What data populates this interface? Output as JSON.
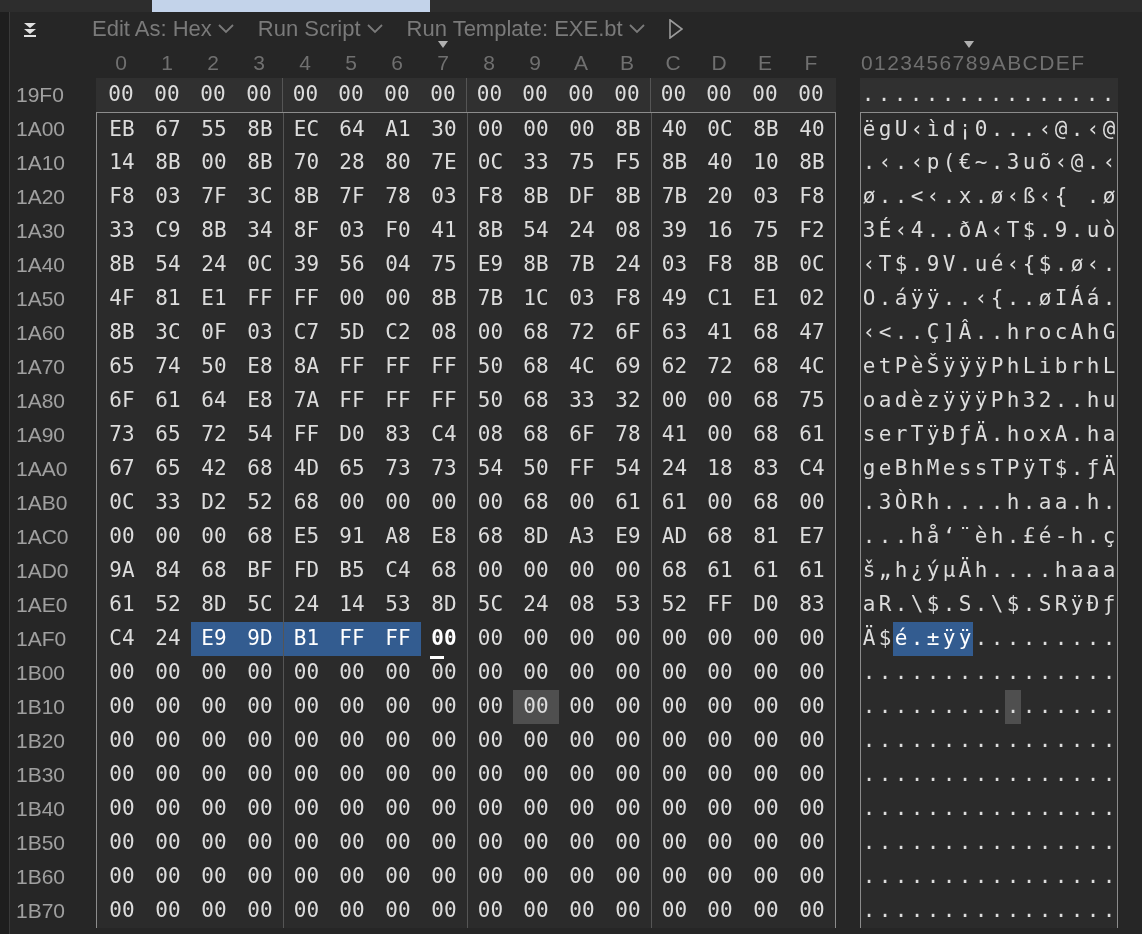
{
  "toolbar": [
    {
      "kind": "dropdown",
      "label": "Edit As: Hex"
    },
    {
      "kind": "dropdown",
      "label": "Run Script"
    },
    {
      "kind": "dropdown",
      "label": "Run Template: EXE.bt"
    },
    {
      "kind": "play"
    }
  ],
  "columns": [
    {
      "label": "0",
      "marked": false
    },
    {
      "label": "1",
      "marked": false
    },
    {
      "label": "2",
      "marked": false
    },
    {
      "label": "3",
      "marked": false
    },
    {
      "label": "4",
      "marked": false
    },
    {
      "label": "5",
      "marked": false
    },
    {
      "label": "6",
      "marked": false
    },
    {
      "label": "7",
      "marked": true
    },
    {
      "label": "8",
      "marked": false
    },
    {
      "label": "9",
      "marked": false
    },
    {
      "label": "A",
      "marked": false
    },
    {
      "label": "B",
      "marked": false
    },
    {
      "label": "C",
      "marked": false
    },
    {
      "label": "D",
      "marked": false
    },
    {
      "label": "E",
      "marked": false
    },
    {
      "label": "F",
      "marked": false
    }
  ],
  "ascii_header": "0123456789ABCDEF",
  "rows": [
    {
      "offset": "19F0",
      "in_template": false,
      "hex": "00 00 00 00 00 00 00 00 00 00 00 00 00 00 00 00",
      "ascii": "................",
      "selected": [
        false,
        false,
        false,
        false,
        false,
        false,
        false,
        false,
        false,
        false,
        false,
        false,
        false,
        false,
        false,
        false
      ],
      "cursor": [
        false,
        false,
        false,
        false,
        false,
        false,
        false,
        false,
        false,
        false,
        false,
        false,
        false,
        false,
        false,
        false
      ],
      "highlighted": [
        false,
        false,
        false,
        false,
        false,
        false,
        false,
        false,
        false,
        false,
        false,
        false,
        false,
        false,
        false,
        false
      ]
    },
    {
      "offset": "1A00",
      "in_template": true,
      "hex": "EB 67 55 8B EC 64 A1 30 00 00 00 8B 40 0C 8B 40",
      "ascii": "ëgU‹ìd¡0...‹@.‹@",
      "selected": [
        false,
        false,
        false,
        false,
        false,
        false,
        false,
        false,
        false,
        false,
        false,
        false,
        false,
        false,
        false,
        false
      ],
      "cursor": [
        false,
        false,
        false,
        false,
        false,
        false,
        false,
        false,
        false,
        false,
        false,
        false,
        false,
        false,
        false,
        false
      ],
      "highlighted": [
        false,
        false,
        false,
        false,
        false,
        false,
        false,
        false,
        false,
        false,
        false,
        false,
        false,
        false,
        false,
        false
      ]
    },
    {
      "offset": "1A10",
      "in_template": true,
      "hex": "14 8B 00 8B 70 28 80 7E 0C 33 75 F5 8B 40 10 8B",
      "ascii": ".‹.‹p(€~.3uõ‹@.‹",
      "selected": [
        false,
        false,
        false,
        false,
        false,
        false,
        false,
        false,
        false,
        false,
        false,
        false,
        false,
        false,
        false,
        false
      ],
      "cursor": [
        false,
        false,
        false,
        false,
        false,
        false,
        false,
        false,
        false,
        false,
        false,
        false,
        false,
        false,
        false,
        false
      ],
      "highlighted": [
        false,
        false,
        false,
        false,
        false,
        false,
        false,
        false,
        false,
        false,
        false,
        false,
        false,
        false,
        false,
        false
      ]
    },
    {
      "offset": "1A20",
      "in_template": true,
      "hex": "F8 03 7F 3C 8B 7F 78 03 F8 8B DF 8B 7B 20 03 F8",
      "ascii": "ø..<‹.x.ø‹ß‹{ .ø",
      "selected": [
        false,
        false,
        false,
        false,
        false,
        false,
        false,
        false,
        false,
        false,
        false,
        false,
        false,
        false,
        false,
        false
      ],
      "cursor": [
        false,
        false,
        false,
        false,
        false,
        false,
        false,
        false,
        false,
        false,
        false,
        false,
        false,
        false,
        false,
        false
      ],
      "highlighted": [
        false,
        false,
        false,
        false,
        false,
        false,
        false,
        false,
        false,
        false,
        false,
        false,
        false,
        false,
        false,
        false
      ]
    },
    {
      "offset": "1A30",
      "in_template": true,
      "hex": "33 C9 8B 34 8F 03 F0 41 8B 54 24 08 39 16 75 F2",
      "ascii": "3É‹4..ðA‹T$.9.uò",
      "selected": [
        false,
        false,
        false,
        false,
        false,
        false,
        false,
        false,
        false,
        false,
        false,
        false,
        false,
        false,
        false,
        false
      ],
      "cursor": [
        false,
        false,
        false,
        false,
        false,
        false,
        false,
        false,
        false,
        false,
        false,
        false,
        false,
        false,
        false,
        false
      ],
      "highlighted": [
        false,
        false,
        false,
        false,
        false,
        false,
        false,
        false,
        false,
        false,
        false,
        false,
        false,
        false,
        false,
        false
      ]
    },
    {
      "offset": "1A40",
      "in_template": true,
      "hex": "8B 54 24 0C 39 56 04 75 E9 8B 7B 24 03 F8 8B 0C",
      "ascii": "‹T$.9V.ué‹{$.ø‹.",
      "selected": [
        false,
        false,
        false,
        false,
        false,
        false,
        false,
        false,
        false,
        false,
        false,
        false,
        false,
        false,
        false,
        false
      ],
      "cursor": [
        false,
        false,
        false,
        false,
        false,
        false,
        false,
        false,
        false,
        false,
        false,
        false,
        false,
        false,
        false,
        false
      ],
      "highlighted": [
        false,
        false,
        false,
        false,
        false,
        false,
        false,
        false,
        false,
        false,
        false,
        false,
        false,
        false,
        false,
        false
      ]
    },
    {
      "offset": "1A50",
      "in_template": true,
      "hex": "4F 81 E1 FF FF 00 00 8B 7B 1C 03 F8 49 C1 E1 02",
      "ascii": "O.áÿÿ..‹{..øIÁá.",
      "selected": [
        false,
        false,
        false,
        false,
        false,
        false,
        false,
        false,
        false,
        false,
        false,
        false,
        false,
        false,
        false,
        false
      ],
      "cursor": [
        false,
        false,
        false,
        false,
        false,
        false,
        false,
        false,
        false,
        false,
        false,
        false,
        false,
        false,
        false,
        false
      ],
      "highlighted": [
        false,
        false,
        false,
        false,
        false,
        false,
        false,
        false,
        false,
        false,
        false,
        false,
        false,
        false,
        false,
        false
      ]
    },
    {
      "offset": "1A60",
      "in_template": true,
      "hex": "8B 3C 0F 03 C7 5D C2 08 00 68 72 6F 63 41 68 47",
      "ascii": "‹<..Ç]Â..hrocAhG",
      "selected": [
        false,
        false,
        false,
        false,
        false,
        false,
        false,
        false,
        false,
        false,
        false,
        false,
        false,
        false,
        false,
        false
      ],
      "cursor": [
        false,
        false,
        false,
        false,
        false,
        false,
        false,
        false,
        false,
        false,
        false,
        false,
        false,
        false,
        false,
        false
      ],
      "highlighted": [
        false,
        false,
        false,
        false,
        false,
        false,
        false,
        false,
        false,
        false,
        false,
        false,
        false,
        false,
        false,
        false
      ]
    },
    {
      "offset": "1A70",
      "in_template": true,
      "hex": "65 74 50 E8 8A FF FF FF 50 68 4C 69 62 72 68 4C",
      "ascii": "etPèŠÿÿÿPhLibrhL",
      "selected": [
        false,
        false,
        false,
        false,
        false,
        false,
        false,
        false,
        false,
        false,
        false,
        false,
        false,
        false,
        false,
        false
      ],
      "cursor": [
        false,
        false,
        false,
        false,
        false,
        false,
        false,
        false,
        false,
        false,
        false,
        false,
        false,
        false,
        false,
        false
      ],
      "highlighted": [
        false,
        false,
        false,
        false,
        false,
        false,
        false,
        false,
        false,
        false,
        false,
        false,
        false,
        false,
        false,
        false
      ]
    },
    {
      "offset": "1A80",
      "in_template": true,
      "hex": "6F 61 64 E8 7A FF FF FF 50 68 33 32 00 00 68 75",
      "ascii": "oadèzÿÿÿPh32..hu",
      "selected": [
        false,
        false,
        false,
        false,
        false,
        false,
        false,
        false,
        false,
        false,
        false,
        false,
        false,
        false,
        false,
        false
      ],
      "cursor": [
        false,
        false,
        false,
        false,
        false,
        false,
        false,
        false,
        false,
        false,
        false,
        false,
        false,
        false,
        false,
        false
      ],
      "highlighted": [
        false,
        false,
        false,
        false,
        false,
        false,
        false,
        false,
        false,
        false,
        false,
        false,
        false,
        false,
        false,
        false
      ]
    },
    {
      "offset": "1A90",
      "in_template": true,
      "hex": "73 65 72 54 FF D0 83 C4 08 68 6F 78 41 00 68 61",
      "ascii": "serTÿÐƒÄ.hoxA.ha",
      "selected": [
        false,
        false,
        false,
        false,
        false,
        false,
        false,
        false,
        false,
        false,
        false,
        false,
        false,
        false,
        false,
        false
      ],
      "cursor": [
        false,
        false,
        false,
        false,
        false,
        false,
        false,
        false,
        false,
        false,
        false,
        false,
        false,
        false,
        false,
        false
      ],
      "highlighted": [
        false,
        false,
        false,
        false,
        false,
        false,
        false,
        false,
        false,
        false,
        false,
        false,
        false,
        false,
        false,
        false
      ]
    },
    {
      "offset": "1AA0",
      "in_template": true,
      "hex": "67 65 42 68 4D 65 73 73 54 50 FF 54 24 18 83 C4",
      "ascii": "geBhMessTPÿT$.ƒÄ",
      "selected": [
        false,
        false,
        false,
        false,
        false,
        false,
        false,
        false,
        false,
        false,
        false,
        false,
        false,
        false,
        false,
        false
      ],
      "cursor": [
        false,
        false,
        false,
        false,
        false,
        false,
        false,
        false,
        false,
        false,
        false,
        false,
        false,
        false,
        false,
        false
      ],
      "highlighted": [
        false,
        false,
        false,
        false,
        false,
        false,
        false,
        false,
        false,
        false,
        false,
        false,
        false,
        false,
        false,
        false
      ]
    },
    {
      "offset": "1AB0",
      "in_template": true,
      "hex": "0C 33 D2 52 68 00 00 00 00 68 00 61 61 00 68 00",
      "ascii": ".3ÒRh....h.aa.h.",
      "selected": [
        false,
        false,
        false,
        false,
        false,
        false,
        false,
        false,
        false,
        false,
        false,
        false,
        false,
        false,
        false,
        false
      ],
      "cursor": [
        false,
        false,
        false,
        false,
        false,
        false,
        false,
        false,
        false,
        false,
        false,
        false,
        false,
        false,
        false,
        false
      ],
      "highlighted": [
        false,
        false,
        false,
        false,
        false,
        false,
        false,
        false,
        false,
        false,
        false,
        false,
        false,
        false,
        false,
        false
      ]
    },
    {
      "offset": "1AC0",
      "in_template": true,
      "hex": "00 00 00 68 E5 91 A8 E8 68 8D A3 E9 AD 68 81 E7",
      "ascii": "...hå‘¨èh.£é-h.ç",
      "selected": [
        false,
        false,
        false,
        false,
        false,
        false,
        false,
        false,
        false,
        false,
        false,
        false,
        false,
        false,
        false,
        false
      ],
      "cursor": [
        false,
        false,
        false,
        false,
        false,
        false,
        false,
        false,
        false,
        false,
        false,
        false,
        false,
        false,
        false,
        false
      ],
      "highlighted": [
        false,
        false,
        false,
        false,
        false,
        false,
        false,
        false,
        false,
        false,
        false,
        false,
        false,
        false,
        false,
        false
      ]
    },
    {
      "offset": "1AD0",
      "in_template": true,
      "hex": "9A 84 68 BF FD B5 C4 68 00 00 00 00 68 61 61 61",
      "ascii": "š„h¿ýµÄh....haaa",
      "selected": [
        false,
        false,
        false,
        false,
        false,
        false,
        false,
        false,
        false,
        false,
        false,
        false,
        false,
        false,
        false,
        false
      ],
      "cursor": [
        false,
        false,
        false,
        false,
        false,
        false,
        false,
        false,
        false,
        false,
        false,
        false,
        false,
        false,
        false,
        false
      ],
      "highlighted": [
        false,
        false,
        false,
        false,
        false,
        false,
        false,
        false,
        false,
        false,
        false,
        false,
        false,
        false,
        false,
        false
      ]
    },
    {
      "offset": "1AE0",
      "in_template": true,
      "hex": "61 52 8D 5C 24 14 53 8D 5C 24 08 53 52 FF D0 83",
      "ascii": "aR.\\$.S.\\$.SRÿÐƒ",
      "selected": [
        false,
        false,
        false,
        false,
        false,
        false,
        false,
        false,
        false,
        false,
        false,
        false,
        false,
        false,
        false,
        false
      ],
      "cursor": [
        false,
        false,
        false,
        false,
        false,
        false,
        false,
        false,
        false,
        false,
        false,
        false,
        false,
        false,
        false,
        false
      ],
      "highlighted": [
        false,
        false,
        false,
        false,
        false,
        false,
        false,
        false,
        false,
        false,
        false,
        false,
        false,
        false,
        false,
        false
      ]
    },
    {
      "offset": "1AF0",
      "in_template": true,
      "hex": "C4 24 E9 9D B1 FF FF 00 00 00 00 00 00 00 00 00",
      "ascii": "Ä$é.±ÿÿ.........",
      "selected": [
        false,
        false,
        true,
        true,
        true,
        true,
        true,
        false,
        false,
        false,
        false,
        false,
        false,
        false,
        false,
        false
      ],
      "cursor": [
        false,
        false,
        false,
        false,
        false,
        false,
        false,
        true,
        false,
        false,
        false,
        false,
        false,
        false,
        false,
        false
      ],
      "highlighted": [
        false,
        false,
        false,
        false,
        false,
        false,
        false,
        false,
        false,
        false,
        false,
        false,
        false,
        false,
        false,
        false
      ]
    },
    {
      "offset": "1B00",
      "in_template": true,
      "hex": "00 00 00 00 00 00 00 00 00 00 00 00 00 00 00 00",
      "ascii": "................",
      "selected": [
        false,
        false,
        false,
        false,
        false,
        false,
        false,
        false,
        false,
        false,
        false,
        false,
        false,
        false,
        false,
        false
      ],
      "cursor": [
        false,
        false,
        false,
        false,
        false,
        false,
        false,
        false,
        false,
        false,
        false,
        false,
        false,
        false,
        false,
        false
      ],
      "highlighted": [
        false,
        false,
        false,
        false,
        false,
        false,
        false,
        false,
        false,
        false,
        false,
        false,
        false,
        false,
        false,
        false
      ]
    },
    {
      "offset": "1B10",
      "in_template": true,
      "hex": "00 00 00 00 00 00 00 00 00 00 00 00 00 00 00 00",
      "ascii": "................",
      "selected": [
        false,
        false,
        false,
        false,
        false,
        false,
        false,
        false,
        false,
        false,
        false,
        false,
        false,
        false,
        false,
        false
      ],
      "cursor": [
        false,
        false,
        false,
        false,
        false,
        false,
        false,
        false,
        false,
        false,
        false,
        false,
        false,
        false,
        false,
        false
      ],
      "highlighted": [
        false,
        false,
        false,
        false,
        false,
        false,
        false,
        false,
        false,
        true,
        false,
        false,
        false,
        false,
        false,
        false
      ]
    },
    {
      "offset": "1B20",
      "in_template": true,
      "hex": "00 00 00 00 00 00 00 00 00 00 00 00 00 00 00 00",
      "ascii": "................",
      "selected": [
        false,
        false,
        false,
        false,
        false,
        false,
        false,
        false,
        false,
        false,
        false,
        false,
        false,
        false,
        false,
        false
      ],
      "cursor": [
        false,
        false,
        false,
        false,
        false,
        false,
        false,
        false,
        false,
        false,
        false,
        false,
        false,
        false,
        false,
        false
      ],
      "highlighted": [
        false,
        false,
        false,
        false,
        false,
        false,
        false,
        false,
        false,
        false,
        false,
        false,
        false,
        false,
        false,
        false
      ]
    },
    {
      "offset": "1B30",
      "in_template": true,
      "hex": "00 00 00 00 00 00 00 00 00 00 00 00 00 00 00 00",
      "ascii": "................",
      "selected": [
        false,
        false,
        false,
        false,
        false,
        false,
        false,
        false,
        false,
        false,
        false,
        false,
        false,
        false,
        false,
        false
      ],
      "cursor": [
        false,
        false,
        false,
        false,
        false,
        false,
        false,
        false,
        false,
        false,
        false,
        false,
        false,
        false,
        false,
        false
      ],
      "highlighted": [
        false,
        false,
        false,
        false,
        false,
        false,
        false,
        false,
        false,
        false,
        false,
        false,
        false,
        false,
        false,
        false
      ]
    },
    {
      "offset": "1B40",
      "in_template": true,
      "hex": "00 00 00 00 00 00 00 00 00 00 00 00 00 00 00 00",
      "ascii": "................",
      "selected": [
        false,
        false,
        false,
        false,
        false,
        false,
        false,
        false,
        false,
        false,
        false,
        false,
        false,
        false,
        false,
        false
      ],
      "cursor": [
        false,
        false,
        false,
        false,
        false,
        false,
        false,
        false,
        false,
        false,
        false,
        false,
        false,
        false,
        false,
        false
      ],
      "highlighted": [
        false,
        false,
        false,
        false,
        false,
        false,
        false,
        false,
        false,
        false,
        false,
        false,
        false,
        false,
        false,
        false
      ]
    },
    {
      "offset": "1B50",
      "in_template": true,
      "hex": "00 00 00 00 00 00 00 00 00 00 00 00 00 00 00 00",
      "ascii": "................",
      "selected": [
        false,
        false,
        false,
        false,
        false,
        false,
        false,
        false,
        false,
        false,
        false,
        false,
        false,
        false,
        false,
        false
      ],
      "cursor": [
        false,
        false,
        false,
        false,
        false,
        false,
        false,
        false,
        false,
        false,
        false,
        false,
        false,
        false,
        false,
        false
      ],
      "highlighted": [
        false,
        false,
        false,
        false,
        false,
        false,
        false,
        false,
        false,
        false,
        false,
        false,
        false,
        false,
        false,
        false
      ]
    },
    {
      "offset": "1B60",
      "in_template": true,
      "hex": "00 00 00 00 00 00 00 00 00 00 00 00 00 00 00 00",
      "ascii": "................",
      "selected": [
        false,
        false,
        false,
        false,
        false,
        false,
        false,
        false,
        false,
        false,
        false,
        false,
        false,
        false,
        false,
        false
      ],
      "cursor": [
        false,
        false,
        false,
        false,
        false,
        false,
        false,
        false,
        false,
        false,
        false,
        false,
        false,
        false,
        false,
        false
      ],
      "highlighted": [
        false,
        false,
        false,
        false,
        false,
        false,
        false,
        false,
        false,
        false,
        false,
        false,
        false,
        false,
        false,
        false
      ]
    },
    {
      "offset": "1B70",
      "in_template": true,
      "hex": "00 00 00 00 00 00 00 00 00 00 00 00 00 00 00 00",
      "ascii": "................",
      "selected": [
        false,
        false,
        false,
        false,
        false,
        false,
        false,
        false,
        false,
        false,
        false,
        false,
        false,
        false,
        false,
        false
      ],
      "cursor": [
        false,
        false,
        false,
        false,
        false,
        false,
        false,
        false,
        false,
        false,
        false,
        false,
        false,
        false,
        false,
        false
      ],
      "highlighted": [
        false,
        false,
        false,
        false,
        false,
        false,
        false,
        false,
        false,
        false,
        false,
        false,
        false,
        false,
        false,
        false
      ]
    }
  ]
}
